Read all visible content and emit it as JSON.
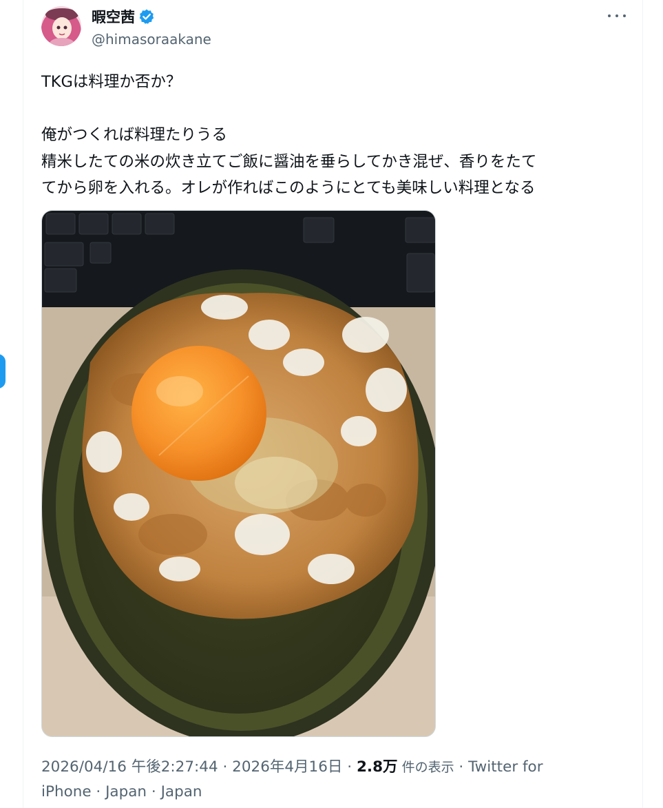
{
  "user": {
    "display_name": "暇空茜",
    "handle": "@himasoraakane",
    "verified": true,
    "verified_color": "#1d9bf0",
    "avatar_icon": "avatar"
  },
  "menu": {
    "more_icon": "more-horizontal-icon"
  },
  "tweet": {
    "lines": [
      "TKGは料理か否か？",
      "",
      "俺がつくれば料理たりうる",
      "精米したての米の炊き立てご飯に醤油を垂らしてかき混ぜ、香りをたて",
      "てから卵を入れる。オレが作ればこのようにとても美味しい料理となる"
    ]
  },
  "media": {
    "subject": "egg-over-rice-bowl-photo"
  },
  "meta": {
    "timestamp": "2026/04/16 午後2:27:44",
    "sep1": " · ",
    "date": "2026年4月16日",
    "sep2": " · ",
    "views_count": "2.8万",
    "views_label": " 件の表示",
    "sep3": " · ",
    "source_1": "Twitter for",
    "source_2": "iPhone",
    "sep4": " · ",
    "location_1": "Japan",
    "sep5": " · ",
    "location_2": "Japan"
  },
  "colors": {
    "text": "#0f1419",
    "muted": "#536471",
    "accent": "#1d9bf0"
  }
}
